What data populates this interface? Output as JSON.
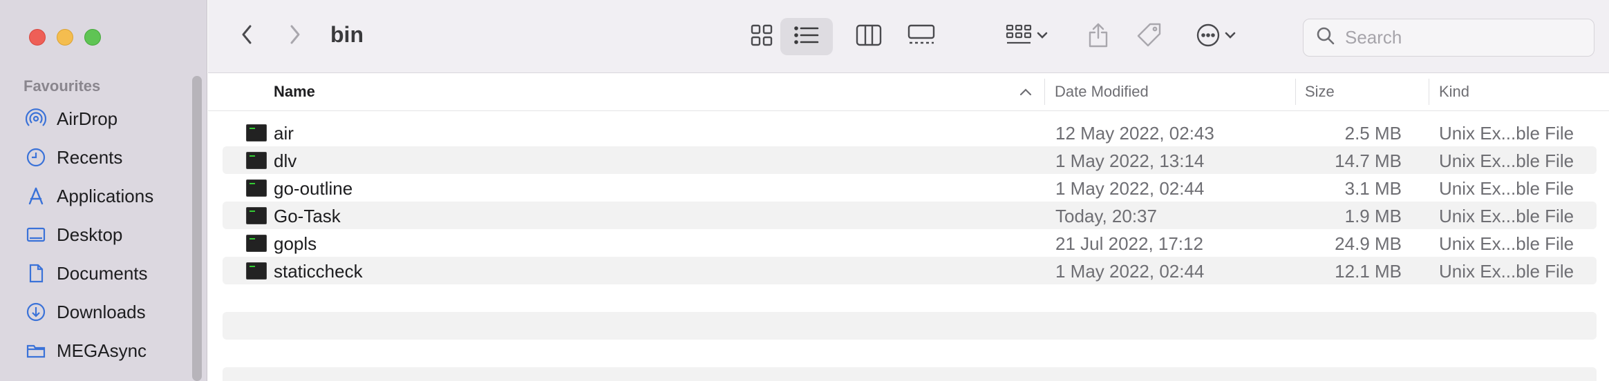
{
  "window": {
    "title": "bin"
  },
  "sidebar": {
    "section_label": "Favourites",
    "items": [
      {
        "label": "AirDrop",
        "icon": "airdrop-icon"
      },
      {
        "label": "Recents",
        "icon": "clock-icon"
      },
      {
        "label": "Applications",
        "icon": "applications-icon"
      },
      {
        "label": "Desktop",
        "icon": "desktop-icon"
      },
      {
        "label": "Documents",
        "icon": "document-icon"
      },
      {
        "label": "Downloads",
        "icon": "download-icon"
      },
      {
        "label": "MEGAsync",
        "icon": "folder-icon"
      }
    ]
  },
  "search": {
    "placeholder": "Search"
  },
  "columns": {
    "name": "Name",
    "date": "Date Modified",
    "size": "Size",
    "kind": "Kind"
  },
  "files": [
    {
      "name": "air",
      "date": "12 May 2022, 02:43",
      "size": "2.5 MB",
      "kind": "Unix Ex...ble File"
    },
    {
      "name": "dlv",
      "date": "1 May 2022, 13:14",
      "size": "14.7 MB",
      "kind": "Unix Ex...ble File"
    },
    {
      "name": "go-outline",
      "date": "1 May 2022, 02:44",
      "size": "3.1 MB",
      "kind": "Unix Ex...ble File"
    },
    {
      "name": "Go-Task",
      "date": "Today, 20:37",
      "size": "1.9 MB",
      "kind": "Unix Ex...ble File"
    },
    {
      "name": "gopls",
      "date": "21 Jul 2022, 17:12",
      "size": "24.9 MB",
      "kind": "Unix Ex...ble File"
    },
    {
      "name": "staticcheck",
      "date": "1 May 2022, 02:44",
      "size": "12.1 MB",
      "kind": "Unix Ex...ble File"
    }
  ],
  "colors": {
    "sidebar_bg": "#dcd8e0",
    "accent": "#3a72d8",
    "alt_row": "#f2f2f2"
  }
}
